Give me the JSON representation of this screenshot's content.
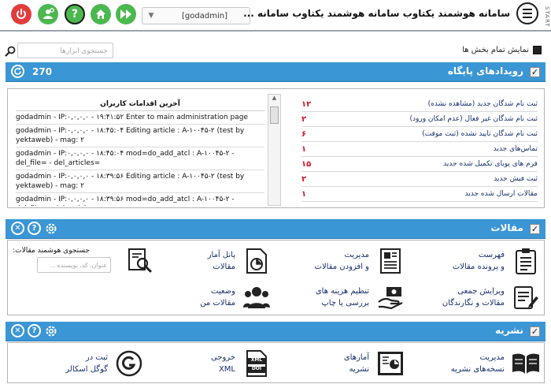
{
  "header": {
    "title": "سامانه هوشمند یکتاوب سامانه هوشمند یکتاوب سامانه ...",
    "start_label": "START",
    "username": "[godadmin]"
  },
  "tools": {
    "search_placeholder": "جستجوی ابزارها",
    "show_all_label": "نمایش تمام بخش ها"
  },
  "events": {
    "title": "رویدادهای پایگاه",
    "count": "270",
    "items": [
      {
        "label": "ثبت نام شدگان جدید (مشاهده نشده)",
        "count": "۱۲"
      },
      {
        "label": "ثبت نام شدگان غیر فعال (عدم امکان ورود)",
        "count": "۲"
      },
      {
        "label": "ثبت نام شدگان تایید نشده (ثبت موقت)",
        "count": "۶"
      },
      {
        "label": "تماس‌های جدید",
        "count": "۱"
      },
      {
        "label": "فرم های پویای تکمیل شده جدید",
        "count": "۱۵"
      },
      {
        "label": "ثبت فیش جدید",
        "count": "۲"
      },
      {
        "label": "مقالات ارسال شده جدید",
        "count": "۱"
      }
    ],
    "log_title": "آخرین اقدامات کاربران",
    "log": [
      "godadmin - IP:۰,۰,۰,۰ - ۱۹:۴۱:۵۲ Enter to main administration page",
      "godadmin - IP:۰,۰,۰,۰ - ۱۸:۴۵:۰۴ Editing article : A-۱۰۰۴۵-۲ (test by yektaweb) - mag: ۲",
      "godadmin - IP:۰,۰,۰,۰ - ۱۸:۴۵:۰۴ mod=do_add_atcl : A-۱۰۰۴۵-۲ - del_file= - del_articles=",
      "godadmin - IP:۰,۰,۰,۰ - ۱۸:۳۹:۵۶ Editing article : A-۱۰۰۴۵-۲ (test by yektaweb) - mag: ۲",
      "godadmin - IP:۰,۰,۰,۰ - ۱۸:۳۹:۵۶ mod=do_add_atcl : A-۱۰۰۴۵-۲ - del_file= - del_articles="
    ]
  },
  "articles": {
    "title": "مقالات",
    "tiles": [
      {
        "line1": "فهرست",
        "line2": "و پرونده مقالات"
      },
      {
        "line1": "مدیریت",
        "line2": "و افزودن مقالات"
      },
      {
        "line1": "پانل آمار",
        "line2": "مقالات"
      },
      {
        "line1": "ویرایش جمعی",
        "line2": "مقالات و نگارندگان"
      },
      {
        "line1": "تنظیم هزینه های",
        "line2": "بررسی یا چاپ"
      },
      {
        "line1": "وضعیت",
        "line2": "مقالات من"
      }
    ],
    "smart_search_label": "جستجوی هوشمند مقالات:",
    "smart_search_placeholder": "عنوان، کد، نویسنده ..."
  },
  "publication": {
    "title": "نشریه",
    "tiles": [
      {
        "line1": "مدیریت",
        "line2": "نسخه‌های نشریه"
      },
      {
        "line1": "آمارهای",
        "line2": "نشریه"
      },
      {
        "line1": "خروجی",
        "line2": "XML"
      },
      {
        "line1": "ثبت در",
        "line2": "گوگل اسکالر"
      }
    ]
  },
  "icons": {
    "xml_doc_top": "XML",
    "xml_doc_bottom": "DOI"
  },
  "colors": {
    "section": "#3a96d5",
    "tile_text": "#16306e",
    "count": "#d9131e",
    "green": "#4bb84f",
    "red": "#e23c3c"
  }
}
